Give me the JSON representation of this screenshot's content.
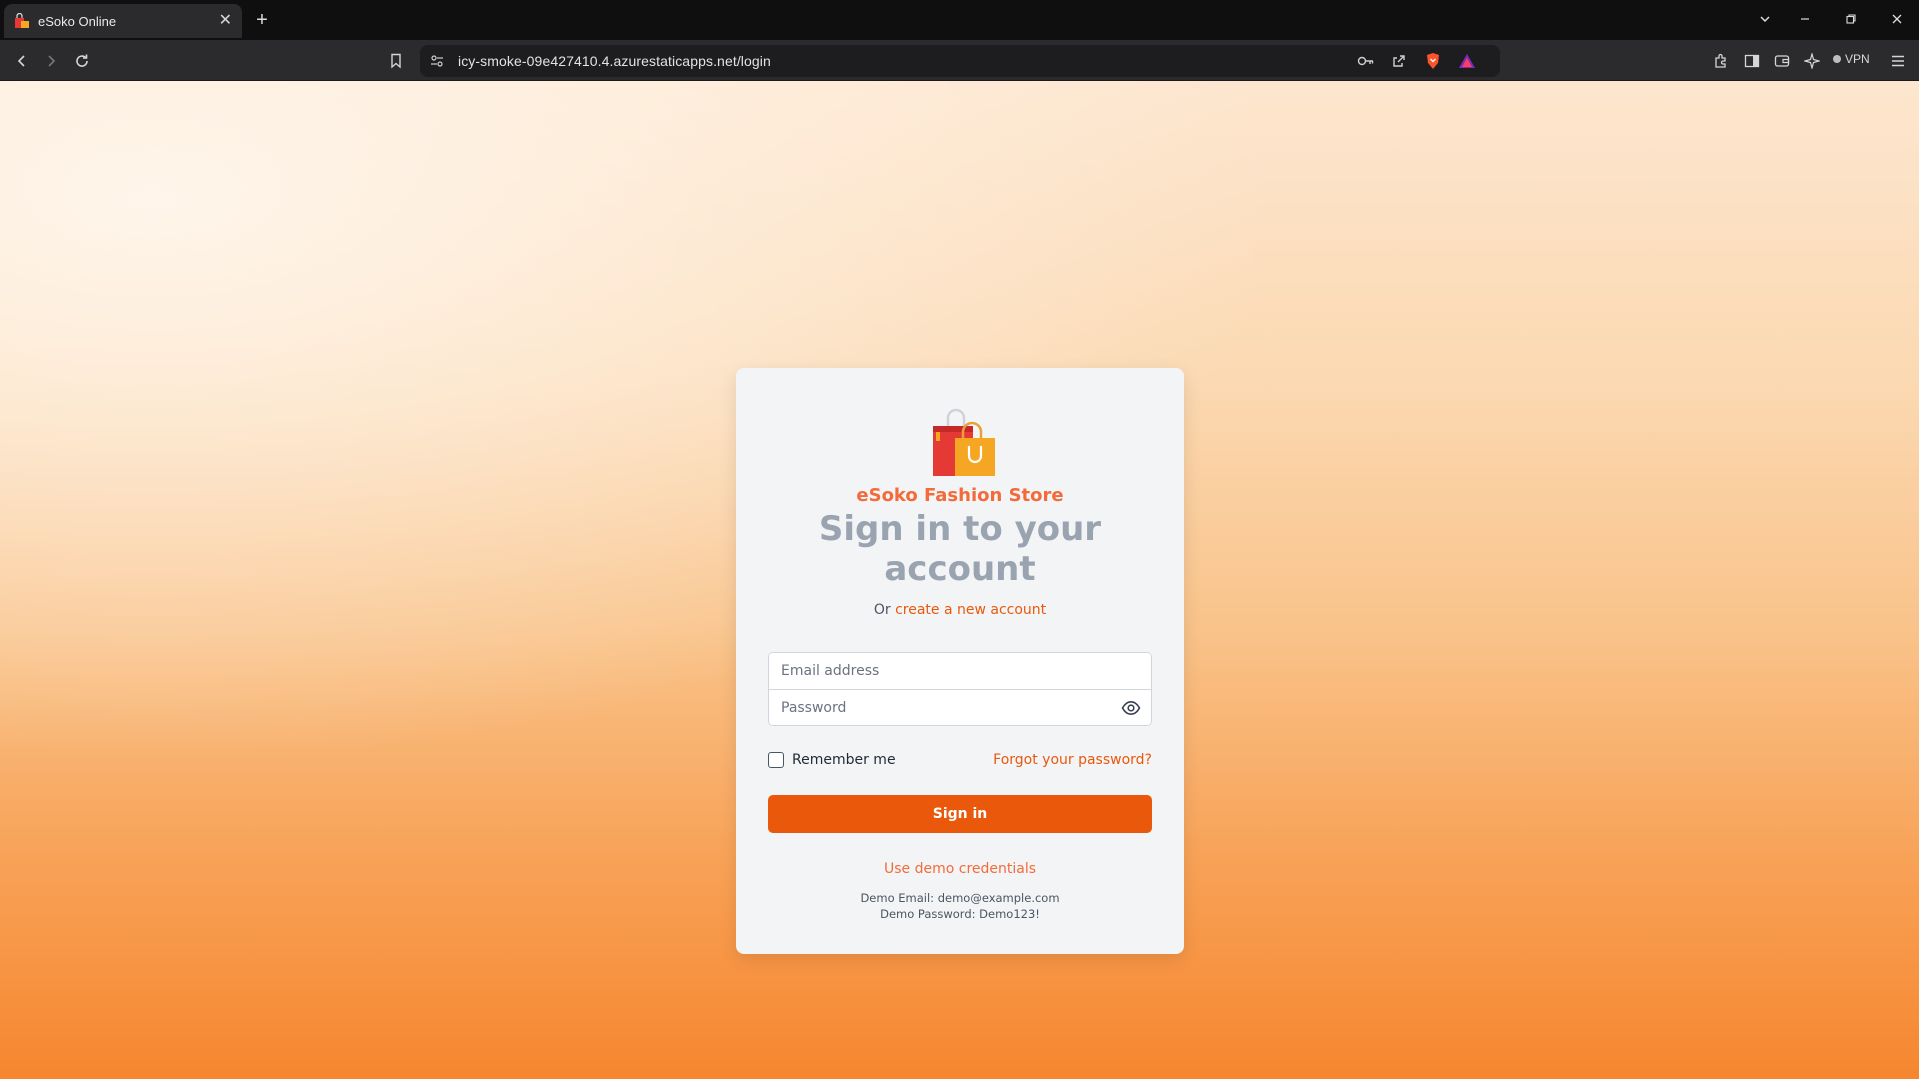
{
  "browser": {
    "tab_title": "eSoko Online",
    "tab_close": "✕",
    "new_tab": "+",
    "url": "icy-smoke-09e427410.4.azurestaticapps.net/login",
    "vpn_label": "VPN",
    "accent_color": "#ea580c"
  },
  "login": {
    "store_name": "eSoko Fashion Store",
    "heading": "Sign in to your account",
    "or_prefix": "Or ",
    "create_account_link": "create a new account",
    "email_placeholder": "Email address",
    "password_placeholder": "Password",
    "remember_label": "Remember me",
    "forgot_link": "Forgot your password?",
    "signin_button": "Sign in",
    "demo_link": "Use demo credentials",
    "demo_email_line": "Demo Email: demo@example.com",
    "demo_password_line": "Demo Password: Demo123!"
  },
  "icons": {
    "logo": "shopping-bags-icon",
    "eye": "eye-icon"
  }
}
